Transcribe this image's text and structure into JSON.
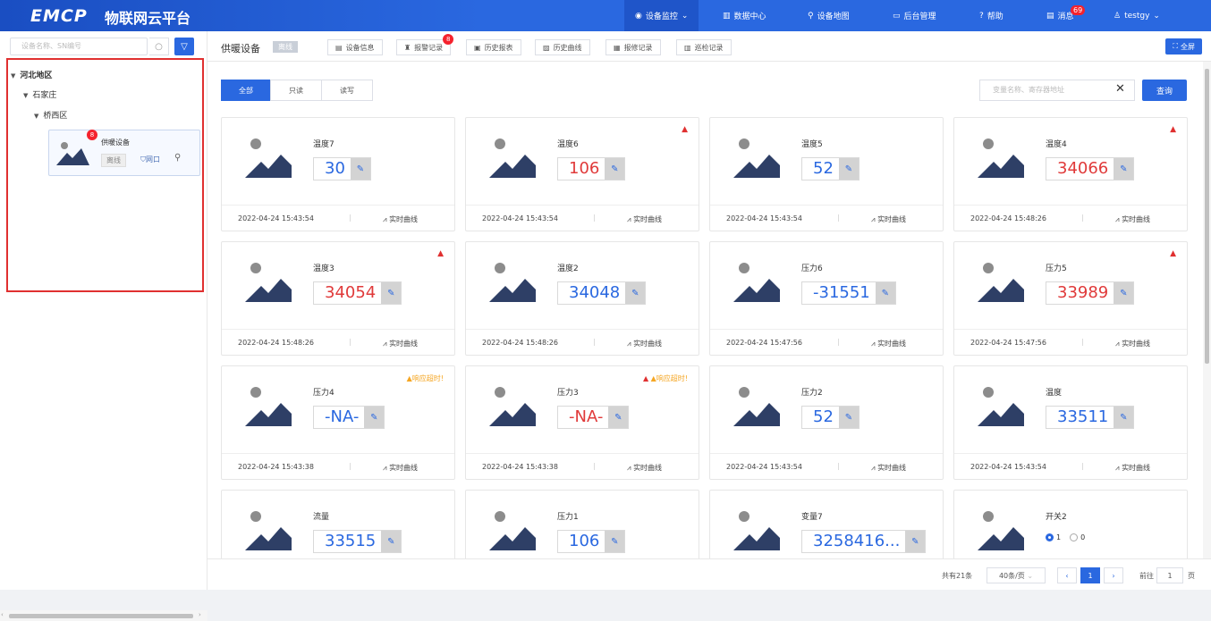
{
  "brand": {
    "logo": "EMCP",
    "title": "物联网云平台"
  },
  "nav": [
    {
      "label": "设备监控",
      "active": true
    },
    {
      "label": "数据中心"
    },
    {
      "label": "设备地图"
    },
    {
      "label": "后台管理"
    },
    {
      "label": "帮助"
    },
    {
      "label": "消息",
      "badge": "69"
    },
    {
      "label": "testgy"
    }
  ],
  "sidebar": {
    "search_placeholder": "设备名称、SN编号",
    "tree": [
      {
        "label": "河北地区",
        "level": 0
      },
      {
        "label": "石家庄",
        "level": 1
      },
      {
        "label": "桥西区",
        "level": 2
      }
    ],
    "device": {
      "name": "供暖设备",
      "status": "离线",
      "net": "网口",
      "badge": "8"
    }
  },
  "header": {
    "device_title": "供暖设备",
    "status": "离线",
    "tabs": [
      {
        "label": "设备信息"
      },
      {
        "label": "报警记录",
        "badge": "8"
      },
      {
        "label": "历史报表"
      },
      {
        "label": "历史曲线"
      },
      {
        "label": "报修记录"
      },
      {
        "label": "巡检记录"
      }
    ],
    "fullscreen": "全屏"
  },
  "filter": {
    "segments": [
      "全部",
      "只读",
      "读写"
    ],
    "active": 0,
    "query_placeholder": "变量名称、寄存器地址",
    "query_button": "查询"
  },
  "cards": [
    {
      "name": "温度7",
      "value": "30",
      "color": "blue",
      "ts": "2022-04-24 15:43:54",
      "alarm": false,
      "warn": ""
    },
    {
      "name": "温度6",
      "value": "106",
      "color": "red",
      "ts": "2022-04-24 15:43:54",
      "alarm": true,
      "warn": ""
    },
    {
      "name": "温度5",
      "value": "52",
      "color": "blue",
      "ts": "2022-04-24 15:43:54",
      "alarm": false,
      "warn": ""
    },
    {
      "name": "温度4",
      "value": "34066",
      "color": "red",
      "ts": "2022-04-24 15:48:26",
      "alarm": true,
      "warn": ""
    },
    {
      "name": "温度3",
      "value": "34054",
      "color": "red",
      "ts": "2022-04-24 15:48:26",
      "alarm": true,
      "warn": ""
    },
    {
      "name": "温度2",
      "value": "34048",
      "color": "blue",
      "ts": "2022-04-24 15:48:26",
      "alarm": false,
      "warn": ""
    },
    {
      "name": "压力6",
      "value": "-31551",
      "color": "blue",
      "ts": "2022-04-24 15:47:56",
      "alarm": false,
      "warn": ""
    },
    {
      "name": "压力5",
      "value": "33989",
      "color": "red",
      "ts": "2022-04-24 15:47:56",
      "alarm": true,
      "warn": ""
    },
    {
      "name": "压力4",
      "value": "-NA-",
      "color": "blue",
      "ts": "2022-04-24 15:43:38",
      "alarm": false,
      "warn": "▲响应超时!"
    },
    {
      "name": "压力3",
      "value": "-NA-",
      "color": "red",
      "ts": "2022-04-24 15:43:38",
      "alarm": true,
      "warn": "▲响应超时!"
    },
    {
      "name": "压力2",
      "value": "52",
      "color": "blue",
      "ts": "2022-04-24 15:43:54",
      "alarm": false,
      "warn": ""
    },
    {
      "name": "温度",
      "value": "33511",
      "color": "blue",
      "ts": "2022-04-24 15:43:54",
      "alarm": false,
      "warn": ""
    },
    {
      "name": "流量",
      "value": "33515",
      "color": "blue",
      "ts": "",
      "alarm": false,
      "warn": ""
    },
    {
      "name": "压力1",
      "value": "106",
      "color": "blue",
      "ts": "",
      "alarm": false,
      "warn": ""
    },
    {
      "name": "变量7",
      "value": "3258416...",
      "color": "blue",
      "ts": "",
      "alarm": false,
      "warn": ""
    },
    {
      "name": "开关2",
      "value": "",
      "color": "blue",
      "ts": "",
      "alarm": false,
      "warn": "",
      "radios": [
        "1",
        "0"
      ],
      "selected": "1"
    }
  ],
  "realtime_label": "实时曲线",
  "pager": {
    "total": "共有21条",
    "size": "40条/页",
    "page": "1",
    "goto": "前往",
    "goto_value": "1",
    "unit": "页"
  },
  "colors": {
    "accent": "#2a68e0",
    "alarm": "#e03030",
    "warn": "#f5a623"
  }
}
